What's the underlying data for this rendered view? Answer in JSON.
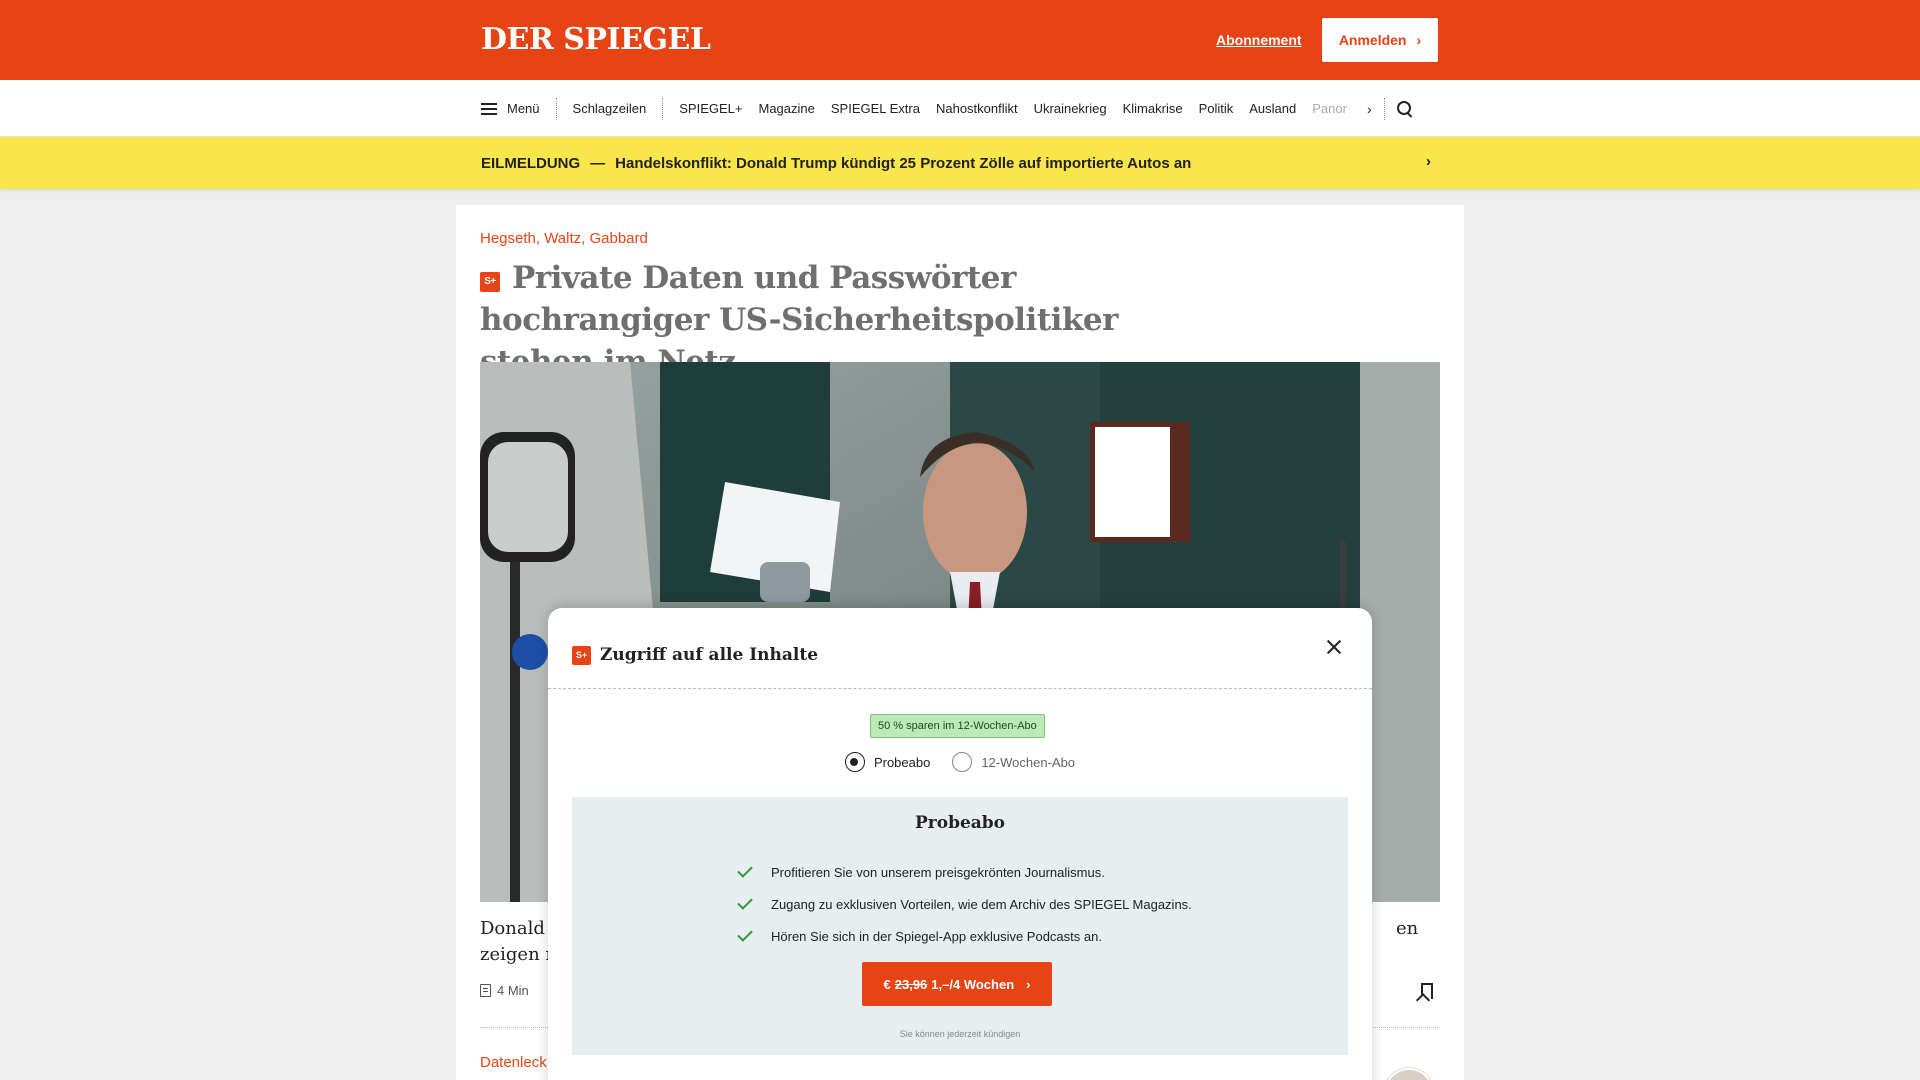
{
  "header": {
    "logo": "DER SPIEGEL",
    "abo_label": "Abonnement",
    "login_label": "Anmelden",
    "brand_color": "#e64415"
  },
  "nav": {
    "menu_label": "Menü",
    "items": [
      "Schlagzeilen",
      "SPIEGEL+",
      "Magazine",
      "SPIEGEL Extra",
      "Nahostkonflikt",
      "Ukrainekrieg",
      "Klimakrise",
      "Politik",
      "Ausland",
      "Panor"
    ]
  },
  "breaking": {
    "tag": "EILMELDUNG",
    "dash": "—",
    "text": "Handelskonflikt: Donald Trump kündigt 25 Prozent Zölle auf importierte Autos an",
    "bg_color": "#f8e64a"
  },
  "article": {
    "kicker": "Hegseth, Waltz, Gabbard",
    "badge": "S+",
    "headline": "Private Daten und Passwörter hochrangiger US-Sicherheitspolitiker stehen im Netz",
    "caption_left_1": "Donald T",
    "caption_left_2": "zeigen nu",
    "caption_right_1": "en",
    "read_time": "4 Min",
    "next_kicker": "Datenleck"
  },
  "modal": {
    "badge": "S+",
    "title": "Zugriff auf alle Inhalte",
    "save_badge": "50 % sparen im 12-Wochen-Abo",
    "options": [
      {
        "label": "Probeabo",
        "selected": true
      },
      {
        "label": "12-Wochen-Abo",
        "selected": false
      }
    ],
    "offer_title": "Probeabo",
    "features": [
      "Profitieren Sie von unserem preisgekrönten Journalismus.",
      "Zugang zu exklusiven Vorteilen, wie dem Archiv des SPIEGEL Magazins.",
      "Hören Sie sich in der Spiegel-App exklusive Podcasts an."
    ],
    "cta_currency": "€",
    "cta_old_price": "23,96",
    "cta_new_price": "1,–/4 Wochen",
    "cancel_note": "Sie können jederzeit kündigen",
    "check_color": "#2a9d3a"
  }
}
